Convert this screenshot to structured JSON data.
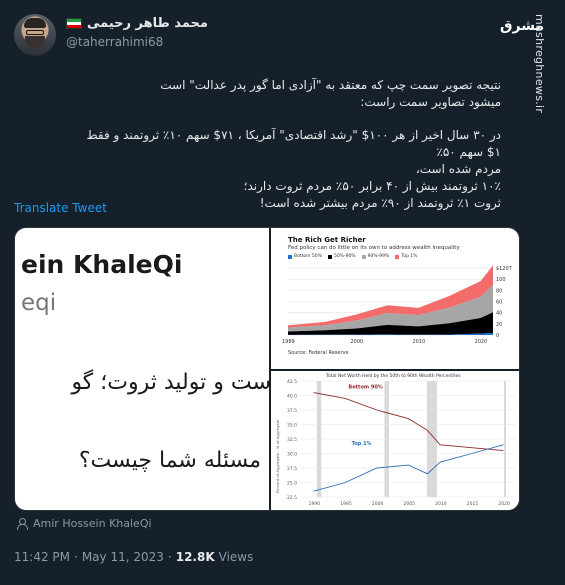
{
  "author": {
    "display_name": "محمد طاهر رحیمی",
    "handle": "@taherrahimi68",
    "flag_colors": [
      "#239f40",
      "#ffffff",
      "#da0000"
    ]
  },
  "watermark": {
    "logo": "مشرق",
    "site": "mashreghnews.ir"
  },
  "tweet": {
    "line1": "نتیجه تصویر سمت چپ که معتقد به \"آزادی اما گور پدر عدالت\" است",
    "line2": "میشود تصاویر سمت راست:",
    "line3": "در ۳۰ سال اخیر از هر ۱۰۰$ \"رشد اقتصادی\" آمریکا ، ۷۱$ سهم ۱۰٪ ثروتمند و فقط ۱$ سهم ۵۰٪",
    "line4": "مردم شده است،",
    "line5": "۱۰٪ ثروتمند بیش از ۴۰ برابر ۵۰٪ مردم ثروت دارند؛",
    "line6": "ثروت ۱٪ ثروتمند از ۹۰٪ مردم بیشتر شده است!",
    "translate_label": "Translate Tweet"
  },
  "media": {
    "left_name": "ein KhaleQi",
    "left_handle": "eqi",
    "left_text1": "است و تولید ثروت؛ گو",
    "left_text2": "مسئله شما چیست؟"
  },
  "chart_data": [
    {
      "type": "area",
      "title": "The Rich Get Richer",
      "subtitle": "Fed policy can do little on its own to address wealth inequality",
      "series_names": [
        "Bottom 50%",
        "50%-90%",
        "90%-99%",
        "Top 1%"
      ],
      "series_colors": [
        "#1f6fd1",
        "#000000",
        "#a6a6a6",
        "#f36b6b"
      ],
      "x": [
        1989,
        1995,
        2000,
        2005,
        2010,
        2015,
        2020,
        2022
      ],
      "stacked_series": [
        {
          "name": "Bottom 50%",
          "values": [
            0.3,
            0.5,
            0.7,
            1.2,
            0.5,
            1.0,
            2.5,
            3.8
          ]
        },
        {
          "name": "50%-90%",
          "values": [
            6,
            8,
            11,
            17,
            15,
            20,
            28,
            37
          ]
        },
        {
          "name": "90%-99%",
          "values": [
            7,
            9,
            14,
            21,
            20,
            28,
            38,
            49
          ]
        },
        {
          "name": "Top 1%",
          "values": [
            4,
            6,
            11,
            14,
            13,
            21,
            28,
            35
          ]
        }
      ],
      "y_ticks": [
        "$120T",
        "100",
        "80",
        "60",
        "40",
        "20",
        "0"
      ],
      "x_ticks": [
        "1989",
        "2000",
        "2010",
        "2020"
      ],
      "ylim": [
        0,
        120
      ],
      "source": "Source: Federal Reserve"
    },
    {
      "type": "line",
      "title": "Total Net Worth Held by the 50th to 90th Wealth Percentiles",
      "ylabel": "Percent of Aggregate - % of Aggregate",
      "x": [
        1990,
        1995,
        2000,
        2005,
        2008,
        2010,
        2015,
        2020
      ],
      "series": [
        {
          "name": "Bottom 90%",
          "values": [
            40.5,
            39.5,
            37.5,
            36.0,
            34.0,
            31.5,
            31.0,
            30.5
          ]
        },
        {
          "name": "Top 1%",
          "values": [
            23.5,
            25.0,
            27.5,
            28.0,
            26.5,
            28.5,
            30.0,
            31.5
          ]
        }
      ],
      "series_colors": [
        "#8b2a2a",
        "#2d6fb3"
      ],
      "y_ticks": [
        "42.5",
        "40.0",
        "37.5",
        "35.0",
        "32.5",
        "30.0",
        "27.5",
        "25.0",
        "22.5"
      ],
      "x_ticks": [
        "1990",
        "1995",
        "2000",
        "2005",
        "2010",
        "2015",
        "2020"
      ],
      "ylim": [
        22.5,
        42.5
      ],
      "recessions": [
        [
          1990.5,
          1991.2
        ],
        [
          2001.2,
          2001.9
        ],
        [
          2007.9,
          2009.5
        ],
        [
          2020.1,
          2020.4
        ]
      ]
    }
  ],
  "attribution": {
    "name": "Amir Hossein KhaleQi"
  },
  "meta": {
    "time": "11:42 PM",
    "separator": "·",
    "date": "May 11, 2023",
    "views_count": "12.8K",
    "views_label": "Views"
  }
}
